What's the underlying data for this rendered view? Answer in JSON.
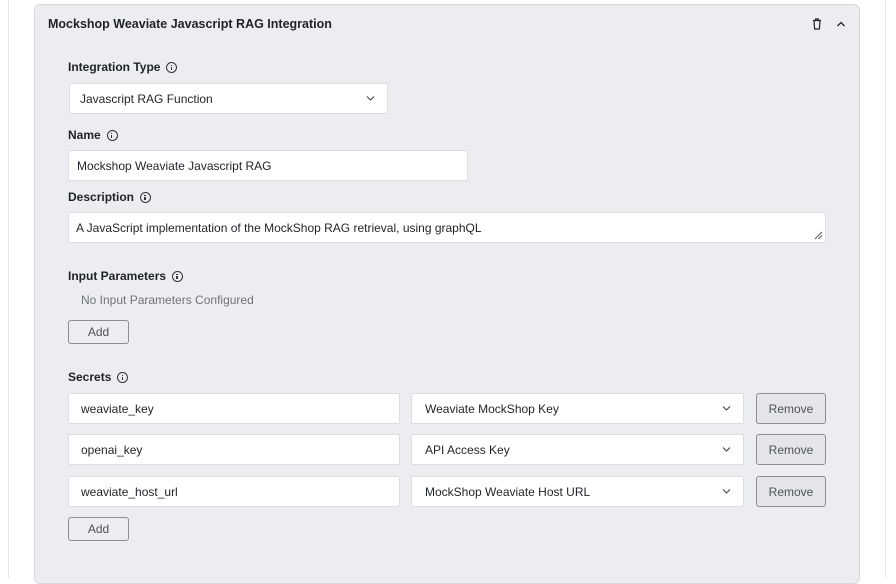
{
  "card": {
    "title": "Mockshop Weaviate Javascript RAG Integration"
  },
  "integration_type": {
    "label": "Integration Type",
    "value": "Javascript RAG Function"
  },
  "name": {
    "label": "Name",
    "value": "Mockshop Weaviate Javascript RAG"
  },
  "description": {
    "label": "Description",
    "value": "A JavaScript implementation of the MockShop RAG retrieval, using graphQL"
  },
  "input_parameters": {
    "label": "Input Parameters",
    "empty_text": "No Input Parameters Configured",
    "add_label": "Add"
  },
  "secrets": {
    "label": "Secrets",
    "add_label": "Add",
    "remove_label": "Remove",
    "rows": [
      {
        "key": "weaviate_key",
        "secret": "Weaviate MockShop Key"
      },
      {
        "key": "openai_key",
        "secret": "API Access Key"
      },
      {
        "key": "weaviate_host_url",
        "secret": "MockShop Weaviate Host URL"
      }
    ]
  },
  "icons": {
    "delete": "trash-icon",
    "collapse": "chevron-up-icon",
    "info": "info-icon",
    "dropdown": "chevron-down-icon"
  }
}
